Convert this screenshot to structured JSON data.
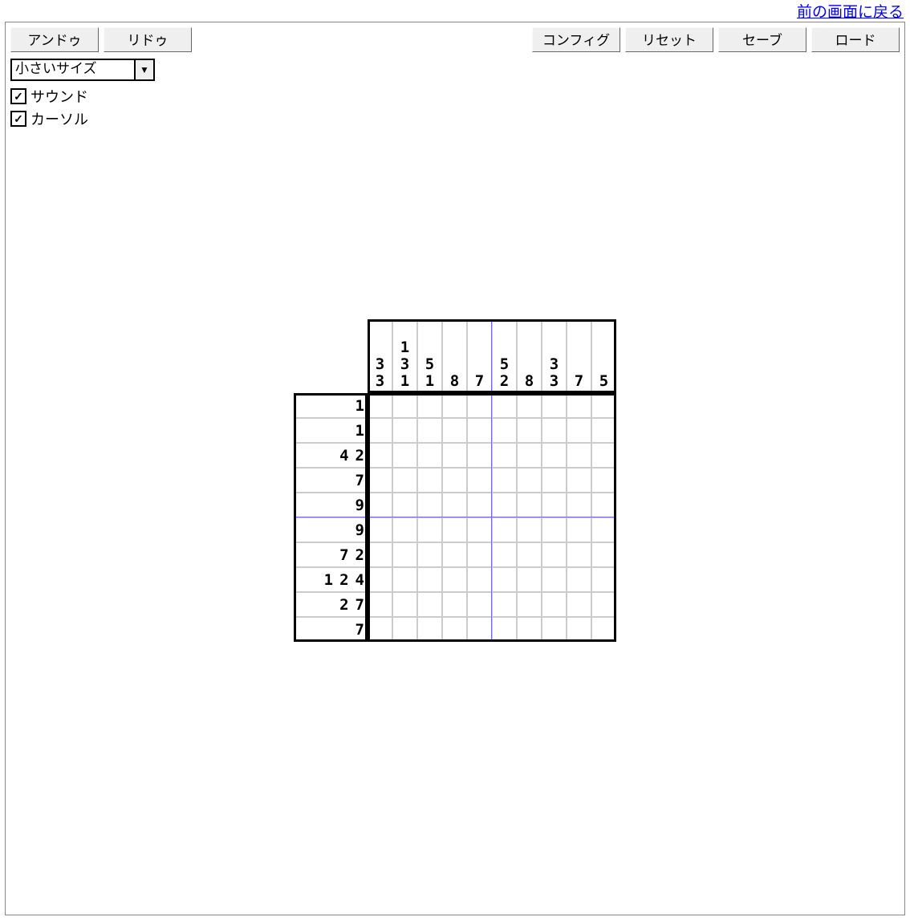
{
  "nav": {
    "back_label": "前の画面に戻る"
  },
  "toolbar": {
    "undo": "アンドゥ",
    "redo": "リドゥ",
    "config": "コンフィグ",
    "reset": "リセット",
    "save": "セーブ",
    "load": "ロード"
  },
  "size_select": {
    "value": "小さいサイズ"
  },
  "options": {
    "sound_label": "サウンド",
    "sound_checked": true,
    "cursor_label": "カーソル",
    "cursor_checked": true
  },
  "puzzle": {
    "grid_size": 10,
    "column_clues": [
      [
        3,
        3
      ],
      [
        1,
        3,
        1
      ],
      [
        5,
        1
      ],
      [
        8
      ],
      [
        7
      ],
      [
        5,
        2
      ],
      [
        8
      ],
      [
        3,
        3
      ],
      [
        7
      ],
      [
        5
      ]
    ],
    "row_clues": [
      [
        1
      ],
      [
        1
      ],
      [
        4,
        2
      ],
      [
        7
      ],
      [
        9
      ],
      [
        9
      ],
      [
        7,
        2
      ],
      [
        1,
        2,
        4
      ],
      [
        2,
        7
      ],
      [
        7
      ]
    ]
  }
}
